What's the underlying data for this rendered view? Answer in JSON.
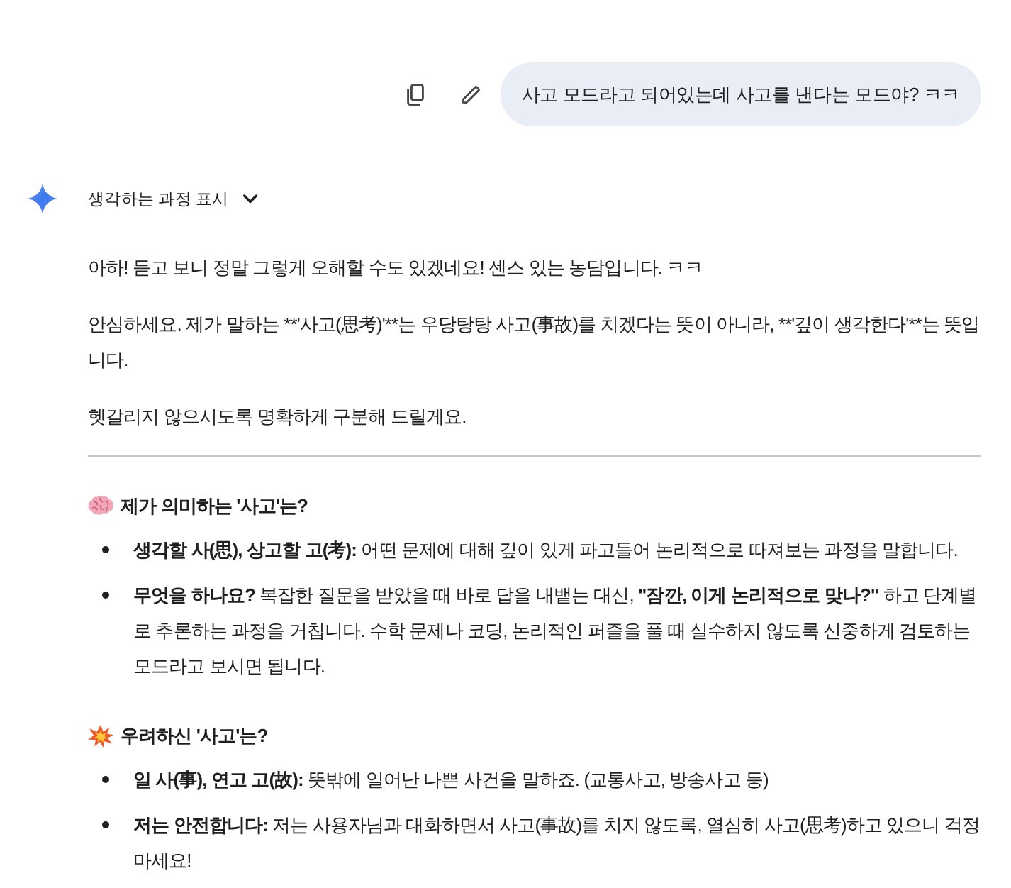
{
  "user_message": {
    "text": "사고 모드라고 되어있는데 사고를 낸다는 모드야? ㅋㅋ"
  },
  "response": {
    "thinking_toggle": {
      "label": "생각하는 과정 표시",
      "expanded": false
    },
    "blocks": [
      {
        "kind": "paragraph",
        "text": "아하! 듣고 보니 정말 그렇게 오해할 수도 있겠네요! 센스 있는 농담입니다. ㅋㅋ"
      },
      {
        "kind": "paragraph",
        "text": "안심하세요. 제가 말하는 **'사고(思考)'**는 우당탕탕 사고(事故)를 치겠다는 뜻이 아니라, **'깊이 생각한다'**는 뜻입니다."
      },
      {
        "kind": "paragraph",
        "text": "헷갈리지 않으시도록 명확하게 구분해 드릴게요."
      },
      {
        "kind": "divider"
      },
      {
        "kind": "heading",
        "text": "제가 의미하는 '사고'는?"
      },
      {
        "kind": "bullets",
        "items": [
          "**생각할 사(思), 상고할 고(考):** 어떤 문제에 대해 깊이 있게 파고들어 논리적으로 따져보는 과정을 말합니다.",
          "**무엇을 하나요?** 복잡한 질문을 받았을 때 바로 답을 내뱉는 대신, **\"잠깐, 이게 논리적으로 맞나?\"** 하고 단계별로 추론하는 과정을 거칩니다. 수학 문제나 코딩, 논리적인 퍼즐을 풀 때 실수하지 않도록 신중하게 검토하는 모드라고 보시면 됩니다."
        ]
      },
      {
        "kind": "heading",
        "text": "우려하신 '사고'는?"
      },
      {
        "kind": "bullets",
        "items": [
          "**일 사(事), 연고 고(故):** 뜻밖에 일어난 나쁜 사건을 말하죠. (교통사고, 방송사고 등)",
          "**저는 안전합니다:** 저는 사용자님과 대화하면서 사고(事故)를 치지 않도록, 열심히 사고(思考)하고 있으니 걱정 마세요!"
        ]
      }
    ]
  }
}
